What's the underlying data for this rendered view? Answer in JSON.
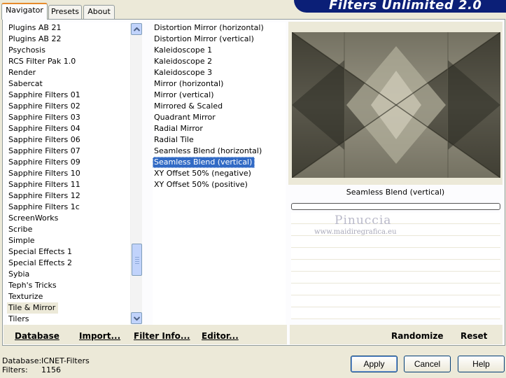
{
  "tabs": [
    {
      "label": "Navigator"
    },
    {
      "label": "Presets"
    },
    {
      "label": "About"
    }
  ],
  "banner_title": "Filters Unlimited 2.0",
  "categories": [
    "Plugins AB 21",
    "Plugins AB 22",
    "Psychosis",
    "RCS Filter Pak 1.0",
    "Render",
    "Sabercat",
    "Sapphire Filters 01",
    "Sapphire Filters 02",
    "Sapphire Filters 03",
    "Sapphire Filters 04",
    "Sapphire Filters 06",
    "Sapphire Filters 07",
    "Sapphire Filters 09",
    "Sapphire Filters 10",
    "Sapphire Filters 11",
    "Sapphire Filters 12",
    "Sapphire Filters 1c",
    "ScreenWorks",
    "Scribe",
    "Simple",
    "Special Effects 1",
    "Special Effects 2",
    "Sybia",
    "Teph's Tricks",
    "Texturize",
    "Tile & Mirror",
    "Tilers"
  ],
  "selected_category": "Tile & Mirror",
  "filters": [
    "Distortion Mirror (horizontal)",
    "Distortion Mirror (vertical)",
    "Kaleidoscope 1",
    "Kaleidoscope 2",
    "Kaleidoscope 3",
    "Mirror (horizontal)",
    "Mirror (vertical)",
    "Mirrored & Scaled",
    "Quadrant Mirror",
    "Radial Mirror",
    "Radial Tile",
    "Seamless Blend (horizontal)",
    "Seamless Blend (vertical)",
    "XY Offset 50% (negative)",
    "XY Offset 50% (positive)"
  ],
  "selected_filter": "Seamless Blend (vertical)",
  "preview_caption": "Seamless Blend (vertical)",
  "watermark": {
    "name": "Pinuccia",
    "site": "www.maidiregrafica.eu"
  },
  "left_buttons": {
    "database": "Database",
    "import": "Import...",
    "filter_info": "Filter Info...",
    "editor": "Editor..."
  },
  "right_buttons": {
    "randomize": "Randomize",
    "reset": "Reset"
  },
  "status": {
    "database_label": "Database:",
    "database_value": "ICNET-Filters",
    "filters_label": "Filters:",
    "filters_value": "1156"
  },
  "dialog_buttons": {
    "apply": "Apply",
    "cancel": "Cancel",
    "help": "Help"
  },
  "colors": {
    "selection": "#316ac5",
    "banner": "#0b1f77",
    "tab_accent": "#e68b2c"
  },
  "scroll_position": 0.85
}
